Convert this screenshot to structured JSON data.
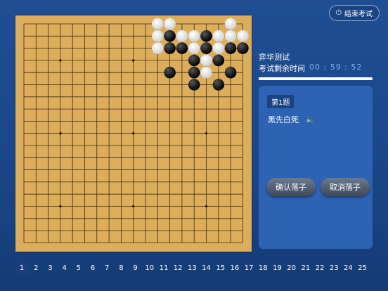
{
  "header": {
    "end_exam_label": "结束考试",
    "end_exam_icon": "power-icon"
  },
  "board": {
    "size": 19,
    "black": [
      [
        12,
        1
      ],
      [
        15,
        1
      ],
      [
        12,
        2
      ],
      [
        13,
        2
      ],
      [
        15,
        2
      ],
      [
        17,
        2
      ],
      [
        18,
        2
      ],
      [
        14,
        3
      ],
      [
        16,
        3
      ],
      [
        12,
        4
      ],
      [
        14,
        4
      ],
      [
        17,
        4
      ],
      [
        14,
        5
      ],
      [
        16,
        5
      ]
    ],
    "white": [
      [
        11,
        0
      ],
      [
        12,
        0
      ],
      [
        17,
        0
      ],
      [
        11,
        1
      ],
      [
        13,
        1
      ],
      [
        14,
        1
      ],
      [
        16,
        1
      ],
      [
        17,
        1
      ],
      [
        18,
        1
      ],
      [
        11,
        2
      ],
      [
        14,
        2
      ],
      [
        16,
        2
      ],
      [
        15,
        3
      ],
      [
        15,
        4
      ]
    ],
    "colors": {
      "board": "#dcae5b",
      "line": "#3a2a12"
    }
  },
  "exam": {
    "title": "弈华测试",
    "timer_label": "考试剩余时间",
    "timer_value": "00 : 59 : 52",
    "progress": 1.0
  },
  "question": {
    "number_label": "第1题",
    "text": "黑先白死",
    "speaker_icon": "speaker-icon",
    "confirm_label": "确认落子",
    "cancel_label": "取消落子"
  },
  "nav": {
    "items": [
      "1",
      "2",
      "3",
      "4",
      "5",
      "6",
      "7",
      "8",
      "9",
      "10",
      "11",
      "12",
      "13",
      "14",
      "15",
      "16",
      "17",
      "18",
      "19",
      "20",
      "21",
      "22",
      "23",
      "24",
      "25"
    ],
    "active_index": 0
  }
}
